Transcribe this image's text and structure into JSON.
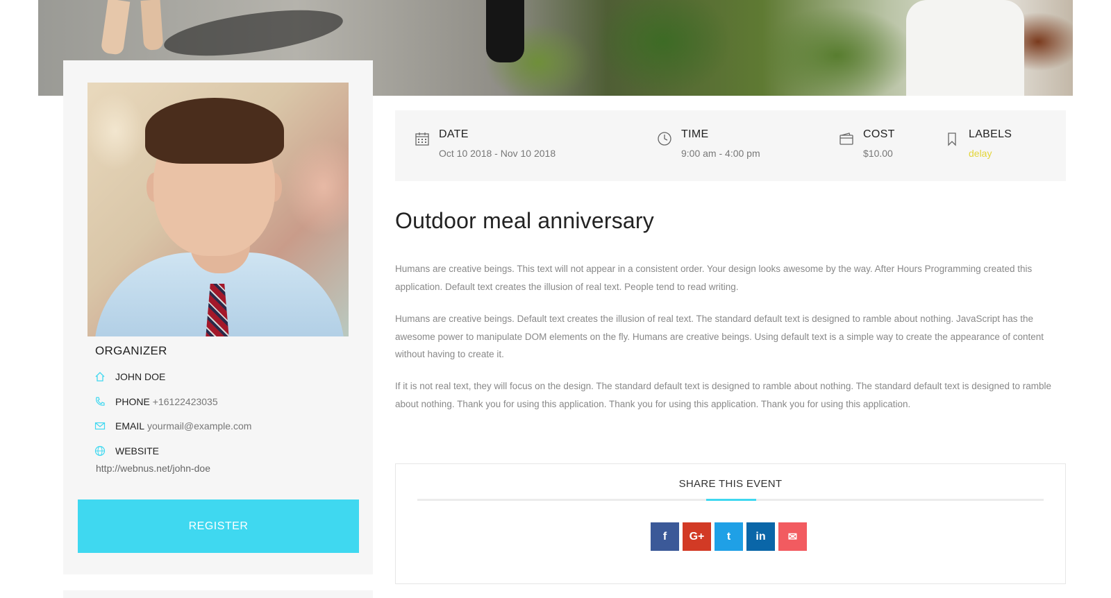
{
  "colors": {
    "accent": "#3fd8f0",
    "label": "#e3d53a",
    "facebook": "#3b5998",
    "googleplus": "#d23a25",
    "twitter": "#1fa0e6",
    "linkedin": "#0a66a8",
    "email": "#f25b60"
  },
  "organizer": {
    "title": "ORGANIZER",
    "name": "JOHN DOE",
    "phone_label": "PHONE",
    "phone_value": "+16122423035",
    "email_label": "EMAIL",
    "email_value": "yourmail@example.com",
    "website_label": "WEBSITE",
    "website_url": "http://webnus.net/john-doe",
    "register_label": "REGISTER",
    "icons": [
      "home-icon",
      "phone-icon",
      "mail-icon",
      "globe-icon"
    ]
  },
  "info": {
    "date_label": "DATE",
    "date_value": "Oct 10 2018 - Nov 10 2018",
    "time_label": "TIME",
    "time_value": "9:00 am - 4:00 pm",
    "cost_label": "COST",
    "cost_value": "$10.00",
    "labels_label": "LABELS",
    "labels_value": "delay"
  },
  "event": {
    "title": "Outdoor meal anniversary",
    "paragraphs": [
      "Humans are creative beings. This text will not appear in a consistent order. Your design looks awesome by the way. After Hours Programming created this application. Default text creates the illusion of real text. People tend to read writing.",
      "Humans are creative beings. Default text creates the illusion of real text. The standard default text is designed to ramble about nothing. JavaScript has the awesome power to manipulate DOM elements on the fly. Humans are creative beings. Using default text is a simple way to create the appearance of content without having to create it.",
      "If it is not real text, they will focus on the design. The standard default text is designed to ramble about nothing. The standard default text is designed to ramble about nothing. Thank you for using this application. Thank you for using this application. Thank you for using this application."
    ]
  },
  "share": {
    "title": "SHARE THIS EVENT",
    "buttons": [
      {
        "icon": "facebook-icon",
        "glyph": "f"
      },
      {
        "icon": "google-plus-icon",
        "glyph": "G+"
      },
      {
        "icon": "twitter-icon",
        "glyph": "t"
      },
      {
        "icon": "linkedin-icon",
        "glyph": "in"
      },
      {
        "icon": "email-icon",
        "glyph": "✉"
      }
    ]
  }
}
